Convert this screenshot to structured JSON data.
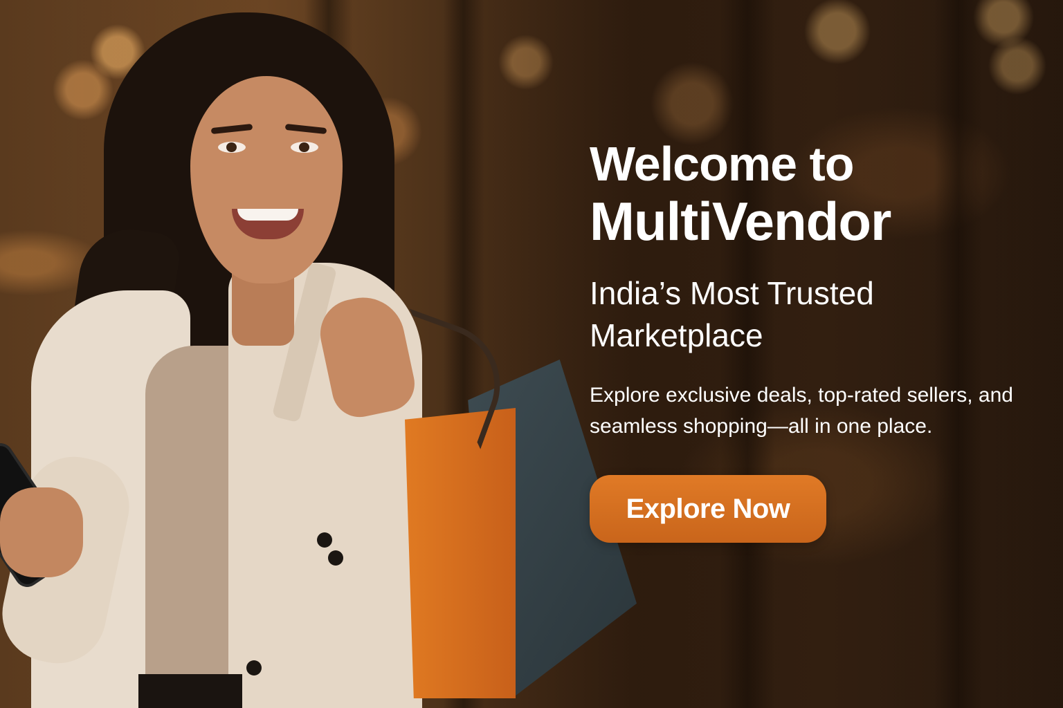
{
  "hero": {
    "headline_line1": "Welcome to",
    "headline_line2": "MultiVendor",
    "subtitle": "India’s Most Trusted Marketplace",
    "description": "Explore exclusive deals, top-rated sellers, and seamless shopping—all in one place.",
    "cta_label": "Explore Now"
  },
  "colors": {
    "accent": "#D9701F",
    "text": "#FFFFFF",
    "background": "#4A2F18"
  }
}
